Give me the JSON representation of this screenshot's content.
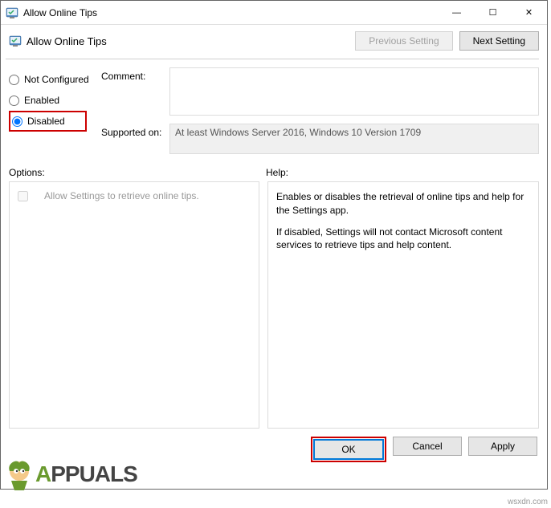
{
  "window": {
    "title": "Allow Online Tips",
    "minimize": "—",
    "maximize": "☐",
    "close": "✕"
  },
  "header": {
    "title": "Allow Online Tips",
    "prev_btn": "Previous Setting",
    "next_btn": "Next Setting"
  },
  "radios": {
    "not_configured": "Not Configured",
    "enabled": "Enabled",
    "disabled": "Disabled",
    "selected": "disabled"
  },
  "comment": {
    "label": "Comment:",
    "value": ""
  },
  "supported": {
    "label": "Supported on:",
    "value": "At least Windows Server 2016, Windows 10 Version 1709"
  },
  "labels": {
    "options": "Options:",
    "help": "Help:"
  },
  "options_item": "Allow Settings to retrieve online tips.",
  "help": {
    "p1": "Enables or disables the retrieval of online tips and help for the Settings app.",
    "p2": "If disabled, Settings will not contact Microsoft content services to retrieve tips and help content."
  },
  "footer": {
    "ok": "OK",
    "cancel": "Cancel",
    "apply": "Apply"
  },
  "branding": {
    "text": "PPUALS",
    "watermark": "wsxdn.com"
  }
}
